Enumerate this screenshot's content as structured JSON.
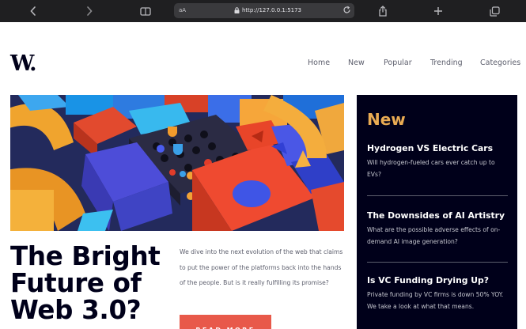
{
  "browser": {
    "text_size_label": "aA",
    "url": "http://127.0.0.1:5173"
  },
  "site": {
    "logo": "W.",
    "nav": [
      "Home",
      "New",
      "Popular",
      "Trending",
      "Categories"
    ]
  },
  "feature": {
    "headline": "The Bright Future of Web 3.0?",
    "lede": "We dive into the next evolution of the web that claims to put the power of the platforms back into the hands of the people. But is it really fulfilling its promise?",
    "cta": "READ MORE"
  },
  "new_panel": {
    "title": "New",
    "items": [
      {
        "title": "Hydrogen VS Electric Cars",
        "desc": "Will hydrogen-fueled cars ever catch up to EVs?"
      },
      {
        "title": "The Downsides of AI Artistry",
        "desc": "What are the possible adverse effects of on-demand AI image generation?"
      },
      {
        "title": "Is VC Funding Drying Up?",
        "desc": "Private funding by VC firms is down 50% YOY. We take a look at what that means."
      }
    ]
  },
  "colors": {
    "accent": "#e9ab53",
    "button": "#e8594a",
    "dark": "#00001a",
    "muted": "#5d5f6d"
  }
}
